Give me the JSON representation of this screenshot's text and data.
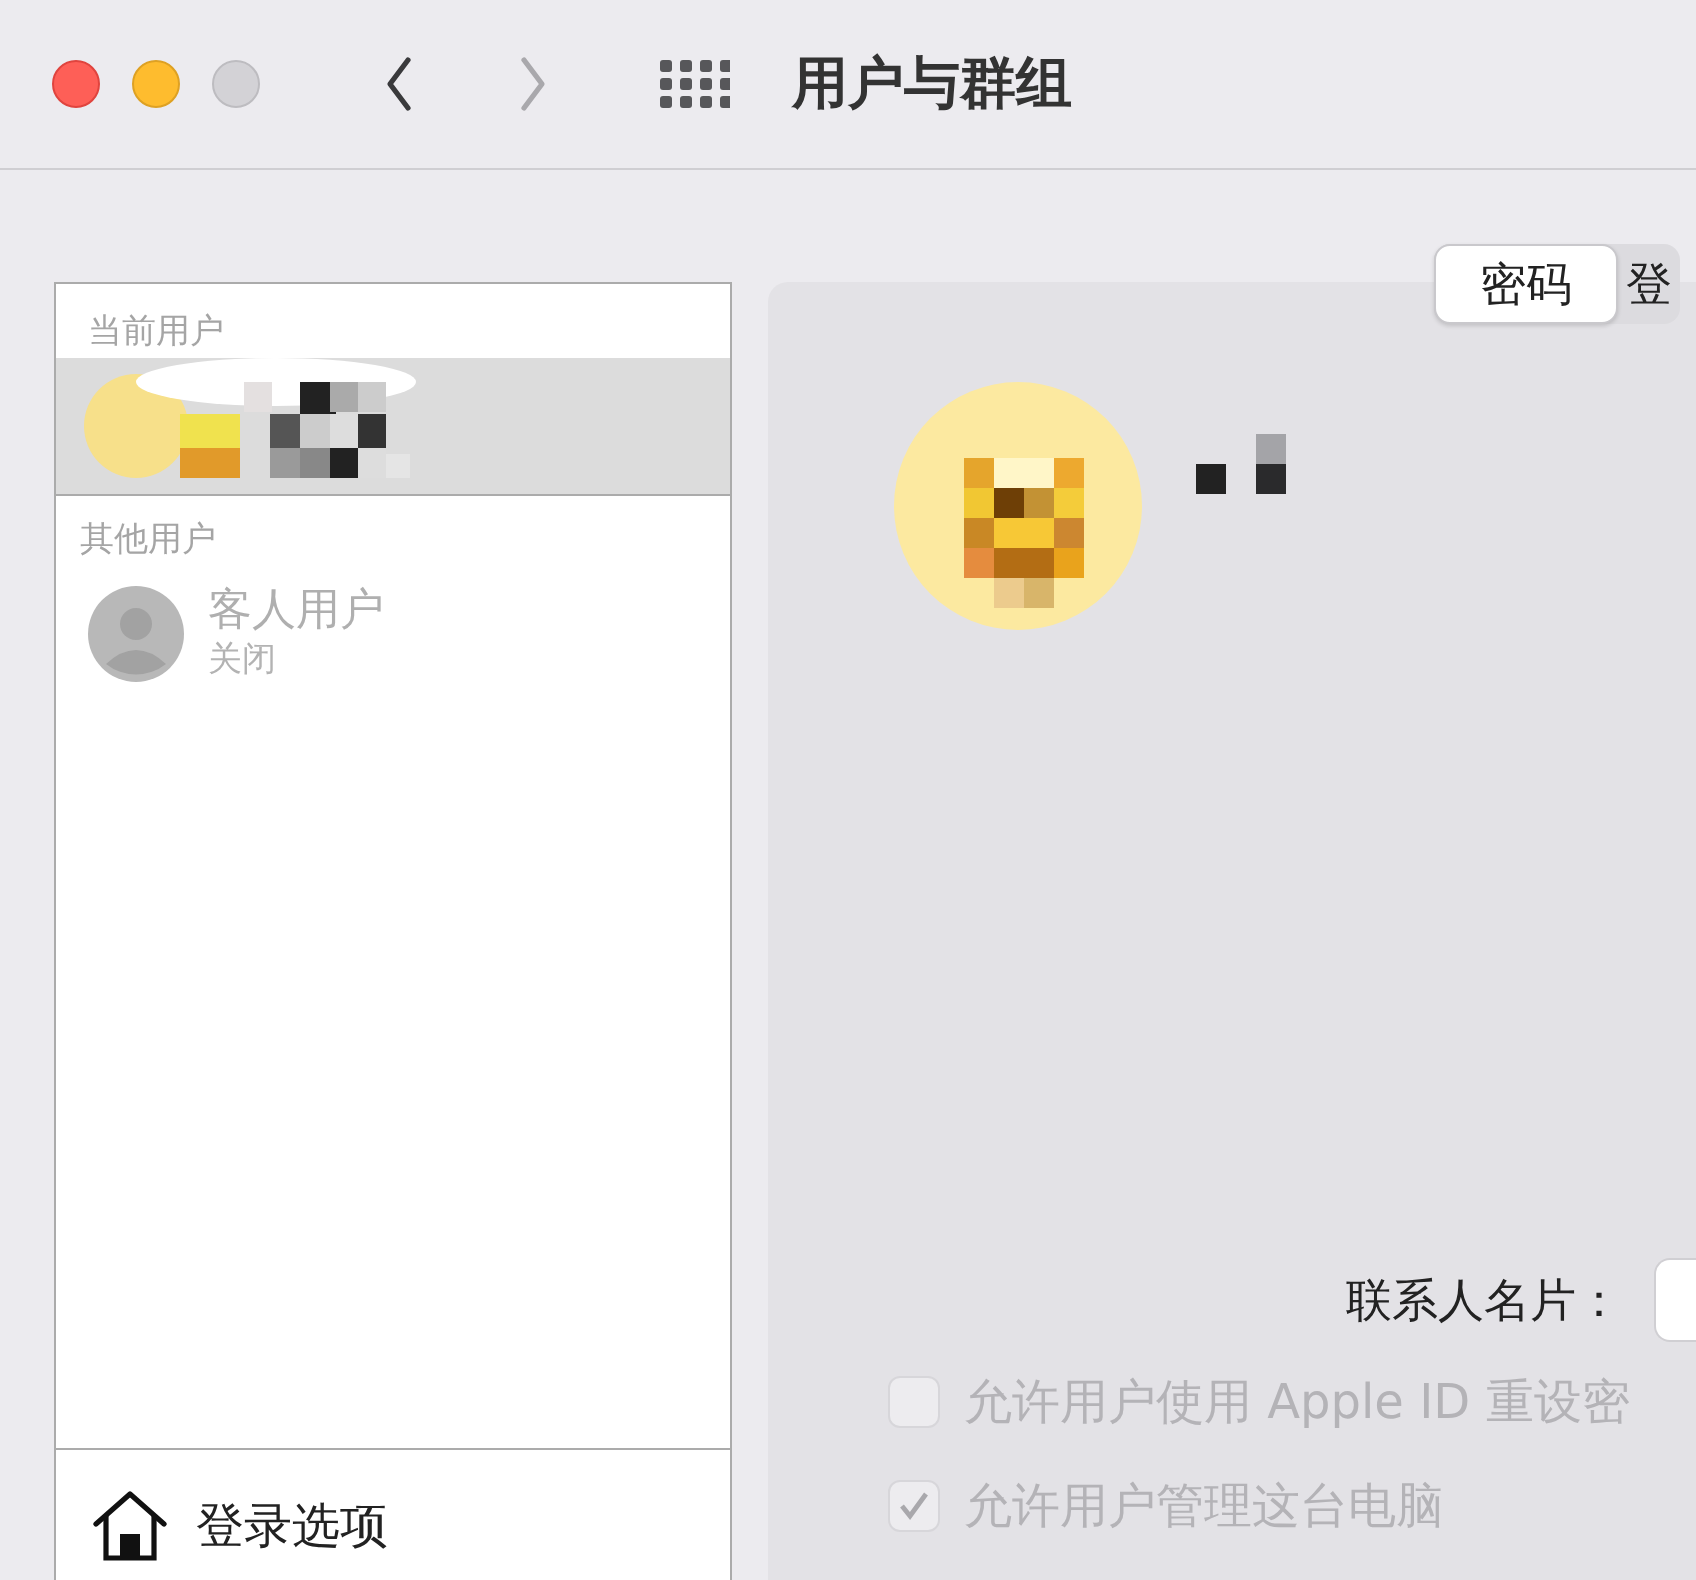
{
  "window": {
    "title": "用户与群组"
  },
  "nav": [
    {
      "kind": "back",
      "disabled": false
    },
    {
      "kind": "forward",
      "disabled": true
    }
  ],
  "sidebar": {
    "sections": [
      {
        "heading": "当前用户",
        "users": [
          {
            "kind": "picture",
            "selected": true
          }
        ]
      },
      {
        "heading": "其他用户",
        "users": [
          {
            "kind": "guest",
            "name": "客人用户",
            "status": "关闭",
            "selected": false
          }
        ]
      }
    ],
    "footer": {
      "label": "登录选项"
    }
  },
  "tabs": [
    {
      "label": "密码",
      "selected": true
    },
    {
      "label": "登",
      "selected": false
    }
  ],
  "details": {
    "contact_card_label": "联系人名片：",
    "options": [
      {
        "label": "允许用户使用 Apple ID 重设密",
        "checked": false,
        "disabled": true
      },
      {
        "label": "允许用户管理这台电脑",
        "checked": true,
        "disabled": true
      }
    ]
  }
}
